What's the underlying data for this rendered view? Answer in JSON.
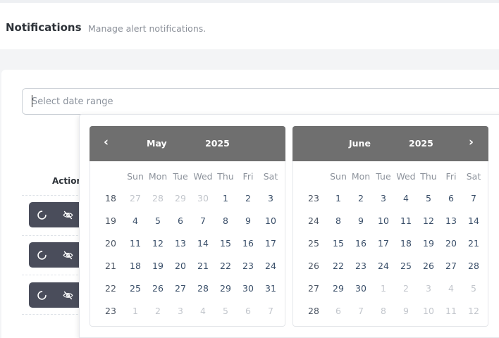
{
  "header": {
    "title": "Notifications",
    "subtitle": "Manage alert notifications."
  },
  "date_range": {
    "placeholder": "Select date range",
    "value": ""
  },
  "table": {
    "column_header": "Action",
    "rows": [
      {
        "actions": [
          "refresh-icon",
          "eye-off-icon"
        ]
      },
      {
        "actions": [
          "refresh-icon",
          "eye-off-icon"
        ]
      },
      {
        "actions": [
          "refresh-icon",
          "eye-off-icon"
        ]
      }
    ]
  },
  "calendar": {
    "nav_prev": "‹",
    "nav_next": "›",
    "months": [
      {
        "month": "May",
        "year": "2025",
        "weekdays": [
          "Sun",
          "Mon",
          "Tue",
          "Wed",
          "Thu",
          "Fri",
          "Sat"
        ],
        "weeks": [
          {
            "wk": "18",
            "days": [
              [
                "27",
                "other"
              ],
              [
                "28",
                "other"
              ],
              [
                "29",
                "other"
              ],
              [
                "30",
                "other"
              ],
              [
                "1",
                "cur"
              ],
              [
                "2",
                "cur"
              ],
              [
                "3",
                "cur"
              ]
            ]
          },
          {
            "wk": "19",
            "days": [
              [
                "4",
                "cur"
              ],
              [
                "5",
                "cur"
              ],
              [
                "6",
                "cur"
              ],
              [
                "7",
                "cur"
              ],
              [
                "8",
                "cur"
              ],
              [
                "9",
                "cur"
              ],
              [
                "10",
                "cur"
              ]
            ]
          },
          {
            "wk": "20",
            "days": [
              [
                "11",
                "cur"
              ],
              [
                "12",
                "cur"
              ],
              [
                "13",
                "cur"
              ],
              [
                "14",
                "cur"
              ],
              [
                "15",
                "cur"
              ],
              [
                "16",
                "cur"
              ],
              [
                "17",
                "cur"
              ]
            ]
          },
          {
            "wk": "21",
            "days": [
              [
                "18",
                "cur"
              ],
              [
                "19",
                "cur"
              ],
              [
                "20",
                "cur"
              ],
              [
                "21",
                "cur"
              ],
              [
                "22",
                "cur"
              ],
              [
                "23",
                "cur"
              ],
              [
                "24",
                "cur"
              ]
            ]
          },
          {
            "wk": "22",
            "days": [
              [
                "25",
                "cur"
              ],
              [
                "26",
                "cur"
              ],
              [
                "27",
                "cur"
              ],
              [
                "28",
                "cur"
              ],
              [
                "29",
                "cur"
              ],
              [
                "30",
                "cur"
              ],
              [
                "31",
                "cur"
              ]
            ]
          },
          {
            "wk": "23",
            "days": [
              [
                "1",
                "other"
              ],
              [
                "2",
                "other"
              ],
              [
                "3",
                "other"
              ],
              [
                "4",
                "other"
              ],
              [
                "5",
                "other"
              ],
              [
                "6",
                "other"
              ],
              [
                "7",
                "other"
              ]
            ]
          }
        ]
      },
      {
        "month": "June",
        "year": "2025",
        "weekdays": [
          "Sun",
          "Mon",
          "Tue",
          "Wed",
          "Thu",
          "Fri",
          "Sat"
        ],
        "weeks": [
          {
            "wk": "23",
            "days": [
              [
                "1",
                "cur"
              ],
              [
                "2",
                "cur"
              ],
              [
                "3",
                "cur"
              ],
              [
                "4",
                "cur"
              ],
              [
                "5",
                "cur"
              ],
              [
                "6",
                "cur"
              ],
              [
                "7",
                "cur"
              ]
            ]
          },
          {
            "wk": "24",
            "days": [
              [
                "8",
                "cur"
              ],
              [
                "9",
                "cur"
              ],
              [
                "10",
                "cur"
              ],
              [
                "11",
                "cur"
              ],
              [
                "12",
                "cur"
              ],
              [
                "13",
                "cur"
              ],
              [
                "14",
                "cur"
              ]
            ]
          },
          {
            "wk": "25",
            "days": [
              [
                "15",
                "cur"
              ],
              [
                "16",
                "cur"
              ],
              [
                "17",
                "cur"
              ],
              [
                "18",
                "cur"
              ],
              [
                "19",
                "cur"
              ],
              [
                "20",
                "cur"
              ],
              [
                "21",
                "cur"
              ]
            ]
          },
          {
            "wk": "26",
            "days": [
              [
                "22",
                "cur"
              ],
              [
                "23",
                "cur"
              ],
              [
                "24",
                "cur"
              ],
              [
                "25",
                "cur"
              ],
              [
                "26",
                "cur"
              ],
              [
                "27",
                "cur"
              ],
              [
                "28",
                "cur"
              ]
            ]
          },
          {
            "wk": "27",
            "days": [
              [
                "29",
                "cur"
              ],
              [
                "30",
                "cur"
              ],
              [
                "1",
                "other"
              ],
              [
                "2",
                "other"
              ],
              [
                "3",
                "other"
              ],
              [
                "4",
                "other"
              ],
              [
                "5",
                "other"
              ]
            ]
          },
          {
            "wk": "28",
            "days": [
              [
                "6",
                "other"
              ],
              [
                "7",
                "other"
              ],
              [
                "8",
                "other"
              ],
              [
                "9",
                "other"
              ],
              [
                "10",
                "other"
              ],
              [
                "11",
                "other"
              ],
              [
                "12",
                "other"
              ]
            ]
          }
        ]
      }
    ]
  },
  "colors": {
    "calendar_header": "#6f6f6f",
    "action_group_bg": "#4a4d5b",
    "day_text": "#3a4f69",
    "other_day_text": "#c2c6cc"
  }
}
